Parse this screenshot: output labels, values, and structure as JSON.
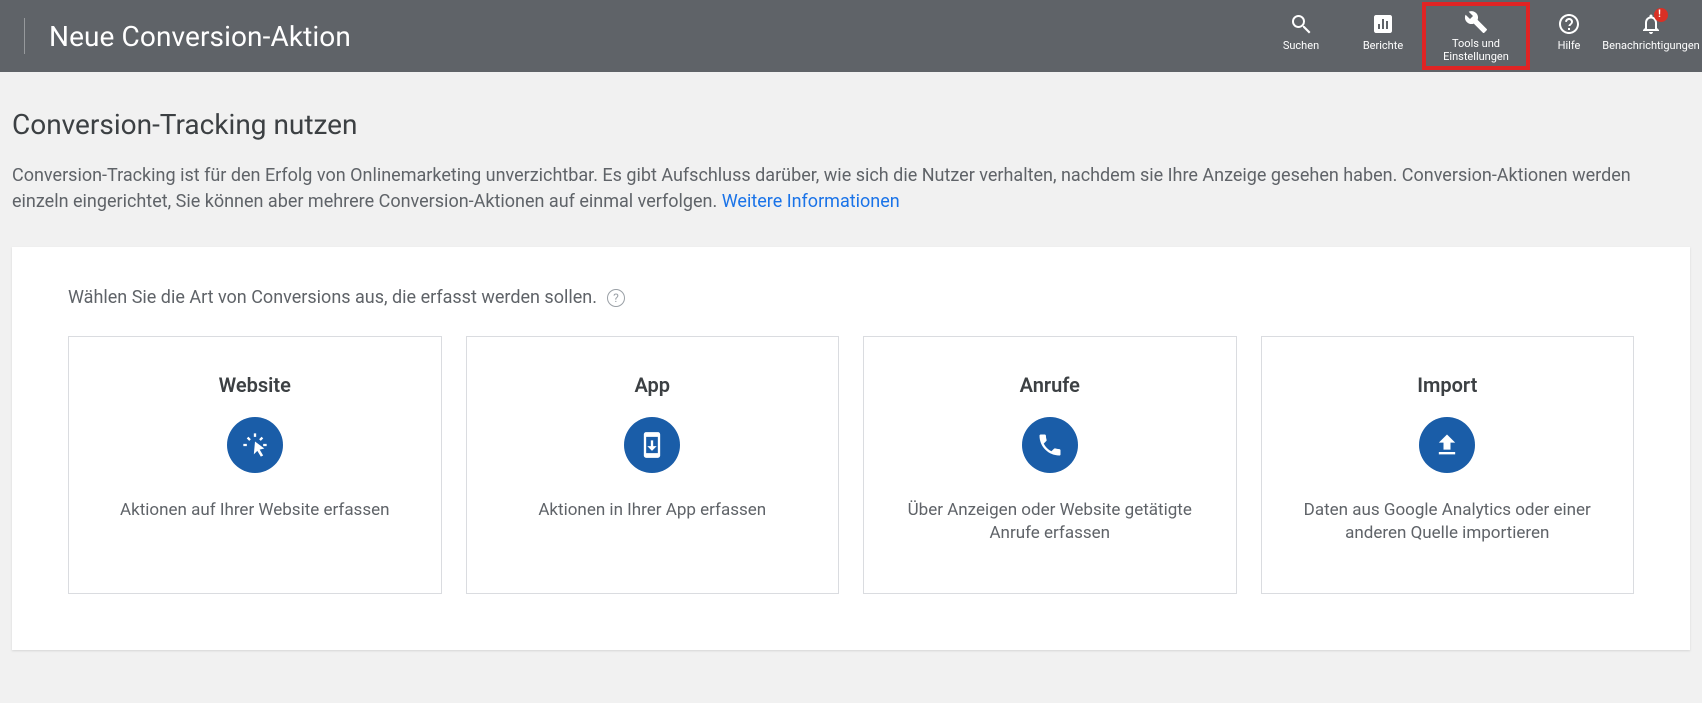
{
  "header": {
    "title": "Neue Conversion-Aktion",
    "nav": {
      "search": "Suchen",
      "reports": "Berichte",
      "tools": "Tools und Einstellungen",
      "help": "Hilfe",
      "notifications": "Benachrichtigungen"
    }
  },
  "main": {
    "heading": "Conversion-Tracking nutzen",
    "description": "Conversion-Tracking ist für den Erfolg von Onlinemarketing unverzichtbar. Es gibt Aufschluss darüber, wie sich die Nutzer verhalten, nachdem sie Ihre Anzeige gesehen haben. Conversion-Aktionen werden einzeln eingerichtet, Sie können aber mehrere Conversion-Aktionen auf einmal verfolgen.  ",
    "learn_more": "Weitere Informationen",
    "prompt": "Wählen Sie die Art von Conversions aus, die erfasst werden sollen.",
    "help_glyph": "?",
    "cards": [
      {
        "title": "Website",
        "desc": "Aktionen auf Ihrer Website erfassen",
        "icon": "cursor-click-icon"
      },
      {
        "title": "App",
        "desc": "Aktionen in Ihrer App erfassen",
        "icon": "app-download-icon"
      },
      {
        "title": "Anrufe",
        "desc": "Über Anzeigen oder Website getätigte Anrufe erfassen",
        "icon": "phone-icon"
      },
      {
        "title": "Import",
        "desc": "Daten aus Google Analytics oder einer anderen Quelle importieren",
        "icon": "upload-icon"
      }
    ]
  }
}
